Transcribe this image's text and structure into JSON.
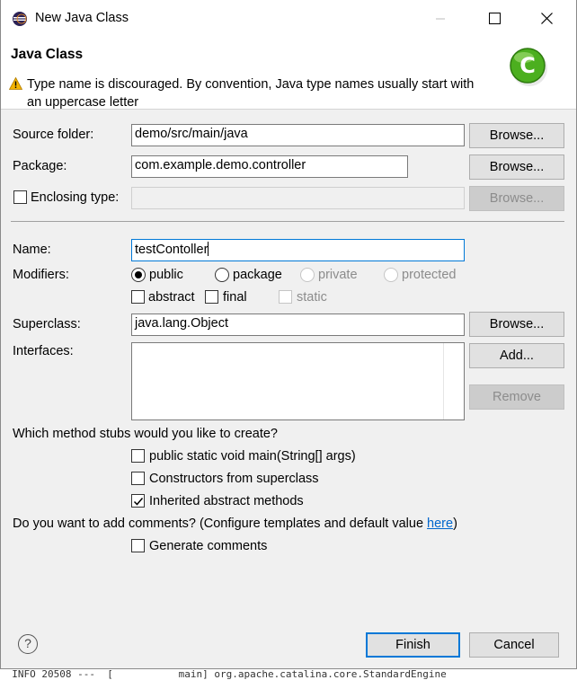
{
  "window": {
    "title": "New Java Class"
  },
  "header": {
    "title": "Java Class",
    "message_line1": "Type name is discouraged. By convention, Java type names usually start with",
    "message_line2": "an uppercase letter"
  },
  "form": {
    "source_folder": {
      "label": "Source folder:",
      "value": "demo/src/main/java",
      "browse": "Browse..."
    },
    "package": {
      "label": "Package:",
      "value": "com.example.demo.controller",
      "browse": "Browse..."
    },
    "enclosing": {
      "label": "Enclosing type:",
      "value": "",
      "browse": "Browse..."
    },
    "name": {
      "label": "Name:",
      "value": "testContoller"
    },
    "modifiers": {
      "label": "Modifiers:",
      "public": "public",
      "package": "package",
      "private": "private",
      "protected": "protected",
      "abstract": "abstract",
      "final": "final",
      "static": "static"
    },
    "superclass": {
      "label": "Superclass:",
      "value": "java.lang.Object",
      "browse": "Browse..."
    },
    "interfaces": {
      "label": "Interfaces:",
      "add": "Add...",
      "remove": "Remove"
    },
    "stubs": {
      "question": "Which method stubs would you like to create?",
      "main": "public static void main(String[] args)",
      "constructors": "Constructors from superclass",
      "inherited": "Inherited abstract methods"
    },
    "comments": {
      "question": "Do you want to add comments? (Configure templates and default value ",
      "link": "here",
      "close": ")",
      "generate": "Generate comments"
    }
  },
  "footer": {
    "help": "?",
    "finish": "Finish",
    "cancel": "Cancel"
  },
  "console": {
    "text": "  INFO 20508 ---  [           main] org.apache.catalina.core.StandardEngine"
  },
  "colors": {
    "accent": "#0078d7",
    "warning": "#f4b400",
    "class_icon": "#4caf1f"
  }
}
